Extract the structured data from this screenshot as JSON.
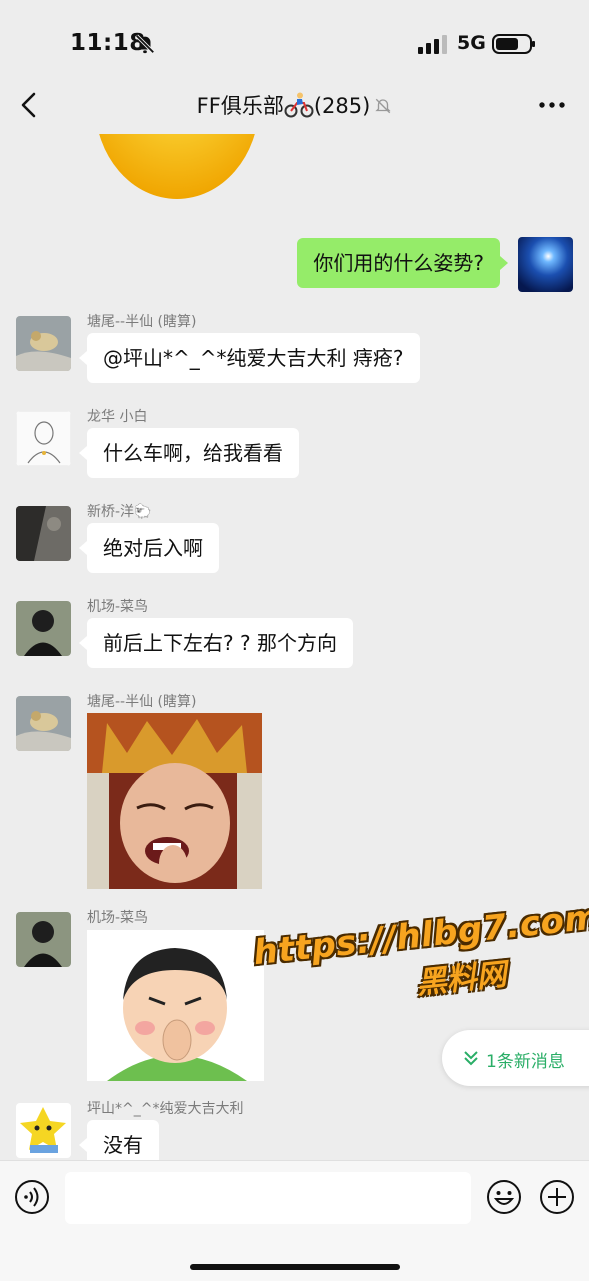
{
  "status_bar": {
    "time": "11:18",
    "network": "5G"
  },
  "nav": {
    "title": "FF俱乐部",
    "member_count": "(285)"
  },
  "messages": [
    {
      "id": "m1",
      "mine": true,
      "text": "你们用的什么姿势?"
    },
    {
      "id": "m2",
      "sender": "塘尾--半仙 (瞎算)",
      "text": "@坪山*^_^*纯爱大吉大利 痔疮?"
    },
    {
      "id": "m3",
      "sender": "龙华  小白",
      "text": "什么车啊，给我看看"
    },
    {
      "id": "m4",
      "sender": "新桥-洋🐑",
      "text": "绝对后入啊"
    },
    {
      "id": "m5",
      "sender": "机场-菜鸟",
      "text": "前后上下左右? ? 那个方向"
    },
    {
      "id": "m6",
      "sender": "塘尾--半仙 (瞎算)",
      "sticker": "laughing-monk-sticker"
    },
    {
      "id": "m7",
      "sender": "机场-菜鸟",
      "sticker": "nose-picking-sticker"
    },
    {
      "id": "m8",
      "sender": "坪山*^_^*纯爱大吉大利",
      "text": "没有"
    }
  ],
  "new_message_pill": {
    "label": "1条新消息"
  },
  "watermark": {
    "url": "https://hlbg7.com",
    "text": "黑料网"
  },
  "input": {
    "value": ""
  },
  "colors": {
    "bg": "#ededed",
    "my_bubble": "#95ec69",
    "other_bubble": "#ffffff",
    "accent": "#2aae67"
  }
}
